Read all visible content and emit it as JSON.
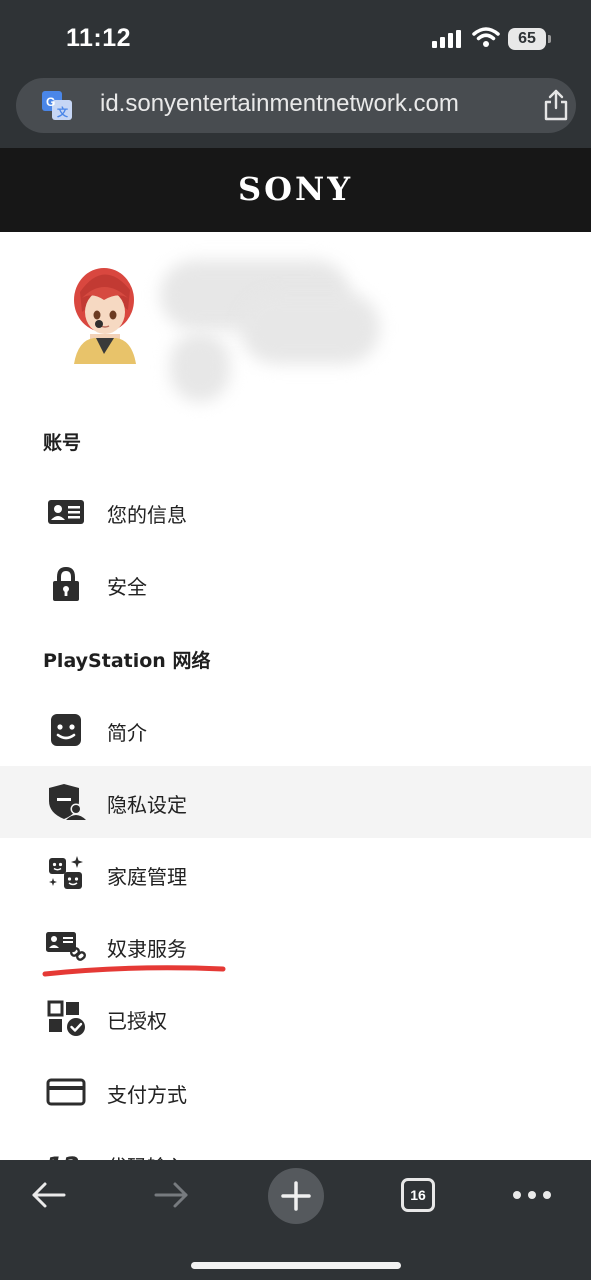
{
  "status_bar": {
    "time": "11:12",
    "battery": "65"
  },
  "browser": {
    "url": "id.sonyentertainmentnetwork.com"
  },
  "header": {
    "brand": "SONY"
  },
  "sections": {
    "account": {
      "title": "账号",
      "items": [
        {
          "label": "您的信息",
          "icon": "id-card-icon"
        },
        {
          "label": "安全",
          "icon": "lock-icon"
        }
      ]
    },
    "psn": {
      "title": "PlayStation 网络",
      "items": [
        {
          "label": "简介",
          "icon": "face-icon"
        },
        {
          "label": "隐私设定",
          "icon": "privacy-shield-icon"
        },
        {
          "label": "家庭管理",
          "icon": "family-icon"
        },
        {
          "label": "奴隶服务",
          "icon": "linked-services-icon"
        },
        {
          "label": "已授权",
          "icon": "authorized-icon"
        },
        {
          "label": "支付方式",
          "icon": "credit-card-icon"
        },
        {
          "label": "代码输入",
          "icon": "code-icon"
        }
      ]
    }
  },
  "bottom_bar": {
    "tab_count": "16"
  },
  "colors": {
    "header_bg": "#171717",
    "chrome_bg": "#2f3336",
    "highlight_bg": "#f4f4f4",
    "underline": "#e53935"
  }
}
